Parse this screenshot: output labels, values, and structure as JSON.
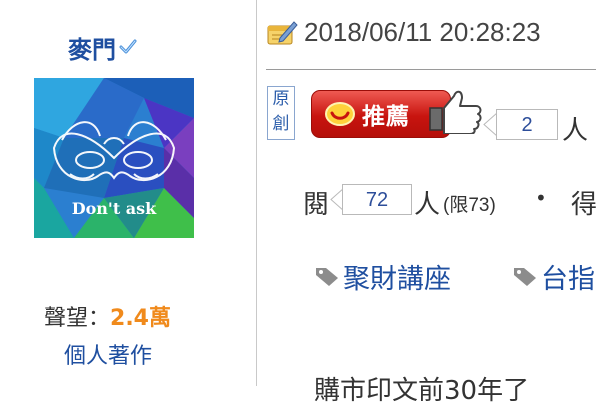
{
  "author": {
    "name": "麥門",
    "avatar_text": "Don't ask",
    "reputation_label": "聲望：",
    "reputation_value": "2.4萬",
    "works_link": "個人著作"
  },
  "post": {
    "datetime": "2018/06/11 20:28:23",
    "original_badge": "原創",
    "recommend_label": "推薦",
    "recommend_count": "2",
    "recommend_unit": "人",
    "read_label": "閱",
    "read_count": "72",
    "read_unit": "人",
    "read_limit": "(限73)",
    "separator": "•",
    "score_label": "得",
    "tags": [
      {
        "label": "聚財講座"
      },
      {
        "label": "台指"
      }
    ],
    "body_snippet": "購市印文前30年了"
  },
  "icons": {
    "verified": "verified-check-icon",
    "date": "pencil-notepad-icon",
    "recommend": "coin-icon",
    "thumbs_up": "thumbs-up-icon",
    "tag": "tag-icon"
  },
  "colors": {
    "link_blue": "#1f4fa0",
    "reputation_orange": "#f08a1c",
    "recommend_red": "#c8140f"
  }
}
